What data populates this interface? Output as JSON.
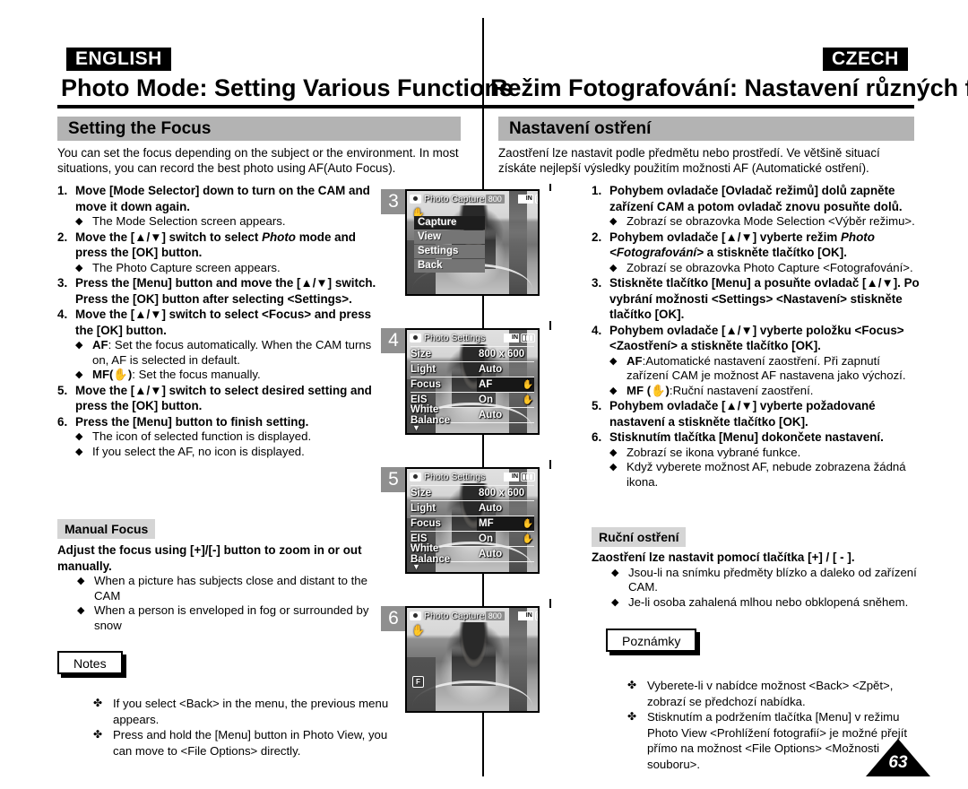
{
  "page": {
    "number": "63"
  },
  "english": {
    "lang_tag": "ENGLISH",
    "title": "Photo Mode: Setting Various Functions",
    "section": "Setting the Focus",
    "intro": "You can set the focus depending on the subject or the environment. In most situations, you can record the best photo using AF(Auto Focus).",
    "steps": [
      {
        "num": "1.",
        "text": "Move [Mode Selector] down to turn on the CAM and move it down again.",
        "bullets": [
          "The Mode Selection screen appears."
        ]
      },
      {
        "num": "2.",
        "text_pre": "Move the [▲/▼] switch to select ",
        "text_italic": "Photo",
        "text_post": " mode and press the [OK] button.",
        "bullets": [
          "The Photo Capture screen appears."
        ]
      },
      {
        "num": "3.",
        "text": "Press the [Menu] button and move the [▲/▼] switch. Press the [OK] button after selecting <Settings>.",
        "bullets": []
      },
      {
        "num": "4.",
        "text": "Move the [▲/▼] switch to select <Focus> and press the [OK] button.",
        "bullets": [
          "AF: Set the focus automatically. When the CAM turns on, AF is selected in default.",
          "MF(✋): Set the focus manually."
        ]
      },
      {
        "num": "5.",
        "text": "Move the [▲/▼] switch to select desired setting and press the [OK] button.",
        "bullets": []
      },
      {
        "num": "6.",
        "text": "Press the [Menu] button to finish setting.",
        "bullets": [
          "The icon of selected function is displayed.",
          "If you select the AF, no icon is displayed."
        ]
      }
    ],
    "sub_heading": "Manual Focus",
    "sub_body": "Adjust the focus using [+]/[-] button to zoom in or out manually.",
    "sub_bullets": [
      "When a picture has subjects close and distant to the CAM",
      "When a person is enveloped in fog or surrounded by snow"
    ],
    "notes_label": "Notes",
    "notes": [
      "If you select <Back> in the menu, the previous menu appears.",
      "Press and hold the [Menu] button in Photo View, you can move to <File Options> directly."
    ]
  },
  "czech": {
    "lang_tag": "CZECH",
    "title": "Režim Fotografování: Nastavení různých funkcí",
    "section": "Nastavení ostření",
    "intro": "Zaostření lze nastavit podle předmětu nebo prostředí. Ve většině situací získáte nejlepší výsledky použitím možnosti AF (Automatické ostření).",
    "steps": [
      {
        "num": "1.",
        "text": "Pohybem ovladače [Ovladač režimů] dolů zapněte zařízení CAM a potom ovladač znovu posuňte dolů.",
        "bullets": [
          "Zobrazí se obrazovka Mode Selection <Výběr režimu>."
        ]
      },
      {
        "num": "2.",
        "text_pre": "Pohybem ovladače [▲/▼] vyberte režim ",
        "text_italic": "Photo <Fotografování>",
        "text_post": " a stiskněte tlačítko [OK].",
        "bullets": [
          "Zobrazí se obrazovka Photo Capture <Fotografování>."
        ]
      },
      {
        "num": "3.",
        "text": "Stiskněte tlačítko [Menu] a posuňte ovladač [▲/▼]. Po vybrání možnosti <Settings> <Nastavení> stiskněte tlačítko [OK].",
        "bullets": []
      },
      {
        "num": "4.",
        "text": "Pohybem ovladače [▲/▼] vyberte položku <Focus> <Zaostření> a stiskněte tlačítko [OK].",
        "bullets": [
          "AF:Automatické nastavení zaostření. Při zapnutí zařízení CAM je možnost AF nastavena jako výchozí.",
          "MF (✋):Ruční nastavení zaostření."
        ]
      },
      {
        "num": "5.",
        "text": "Pohybem ovladače [▲/▼] vyberte požadované nastavení a stiskněte tlačítko [OK].",
        "bullets": []
      },
      {
        "num": "6.",
        "text": "Stisknutím tlačítka [Menu] dokončete nastavení.",
        "bullets": [
          "Zobrazí se ikona vybrané funkce.",
          "Když vyberete možnost AF, nebude zobrazena žádná ikona."
        ]
      }
    ],
    "sub_heading": "Ruční ostření",
    "sub_body": "Zaostření lze nastavit pomocí tlačítka [+] / [ - ].",
    "sub_bullets": [
      "Jsou-li na snímku předměty blízko a daleko od zařízení CAM.",
      "Je-li osoba zahalená mlhou nebo obklopená sněhem."
    ],
    "notes_label": "Poznámky",
    "notes": [
      "Vyberete-li v nabídce možnost <Back> <Zpět>, zobrazí se předchozí nabídka.",
      "Stisknutím a podržením tlačítka [Menu] v režimu Photo View <Prohlížení fotografií> je možné přejít přímo na možnost <File Options> <Možnosti souboru>."
    ]
  },
  "screenshots": [
    {
      "step_number": "3",
      "osd_title": "Photo Capture",
      "osd_count": "800",
      "osd_storage": "IN",
      "menu_items": [
        {
          "label": "Capture",
          "selected": true
        },
        {
          "label": "View",
          "selected": false
        },
        {
          "label": "Settings",
          "selected": false
        },
        {
          "label": "Back",
          "selected": false
        }
      ]
    },
    {
      "step_number": "4",
      "osd_title": "Photo Settings",
      "osd_storage": "IN",
      "rows": [
        {
          "label": "Size",
          "value": "800 x 600",
          "selected": false
        },
        {
          "label": "Light",
          "value": "Auto",
          "selected": false
        },
        {
          "label": "Focus",
          "value": "AF",
          "selected": true
        },
        {
          "label": "EIS",
          "value": "On",
          "selected": false
        },
        {
          "label": "White Balance",
          "value": "Auto",
          "selected": false
        }
      ]
    },
    {
      "step_number": "5",
      "osd_title": "Photo Settings",
      "osd_storage": "IN",
      "rows": [
        {
          "label": "Size",
          "value": "800 x 600",
          "selected": false
        },
        {
          "label": "Light",
          "value": "Auto",
          "selected": false
        },
        {
          "label": "Focus",
          "value": "MF",
          "selected": true
        },
        {
          "label": "EIS",
          "value": "On",
          "selected": false
        },
        {
          "label": "White Balance",
          "value": "Auto",
          "selected": false
        }
      ]
    },
    {
      "step_number": "6",
      "osd_title": "Photo Capture",
      "osd_count": "800",
      "osd_storage": "IN",
      "mf_icon_label": "F"
    }
  ],
  "colors": {
    "section_bar": "#b3b3b3",
    "sub_heading": "#d5d5d5",
    "shot_number": "#8f8f8f",
    "lang_tag_bg": "#000000"
  }
}
